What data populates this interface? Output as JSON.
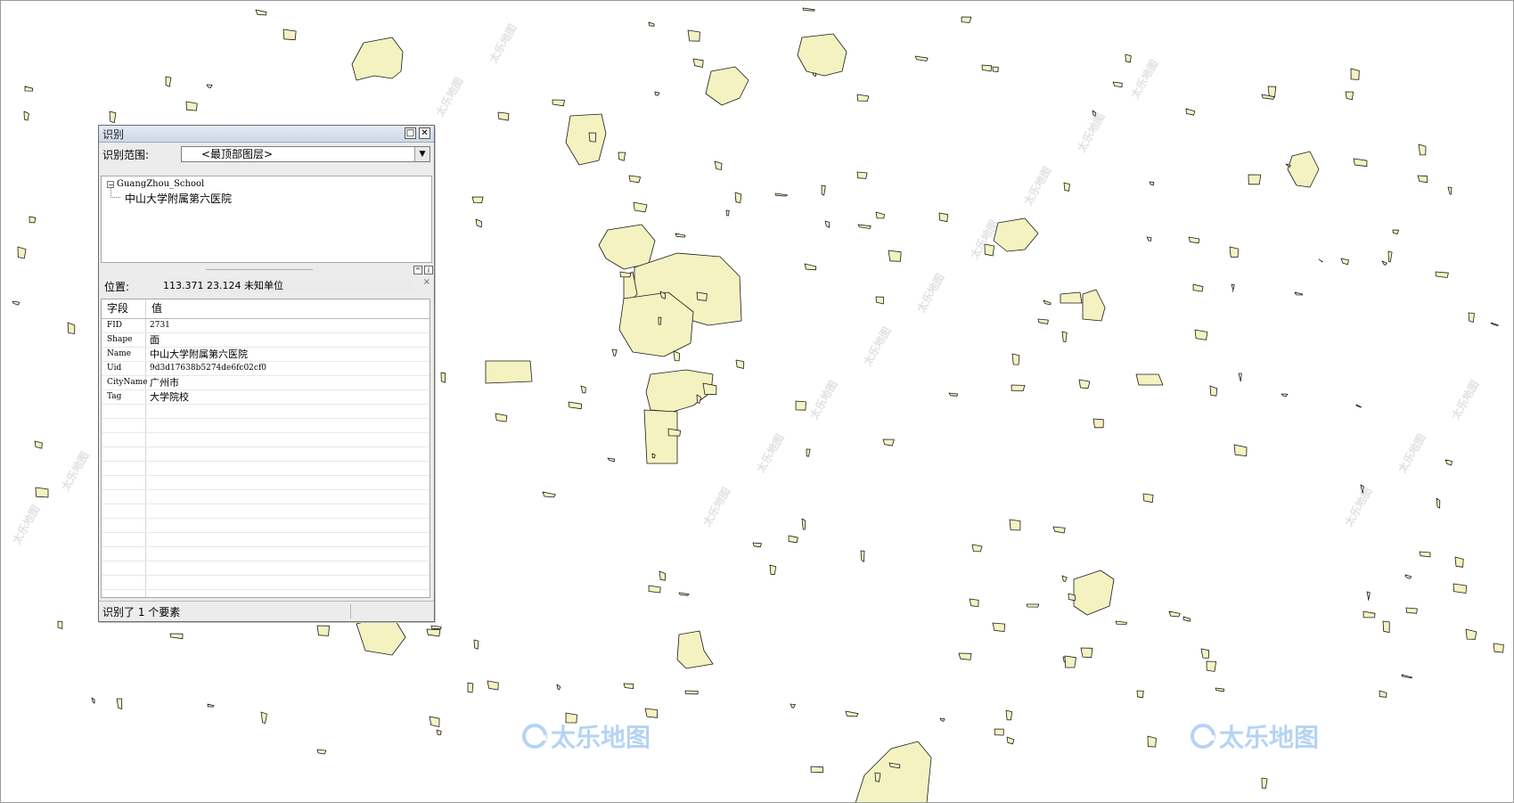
{
  "identify_window": {
    "title": "识别",
    "maximize_glyph": "□",
    "close_glyph": "✕",
    "scope_label": "识别范围:",
    "scope_value": "<最顶部图层>",
    "scope_arrow": "▼",
    "tree": {
      "layer_name": "GuangZhou_School",
      "toggle_glyph": "−",
      "feature_name": "中山大学附属第六医院"
    },
    "splitter": {
      "collapse_glyph": "^",
      "pin_glyph": "i"
    },
    "location": {
      "label": "位置:",
      "value": "113.371  23.124 未知单位",
      "clear_glyph": "×"
    },
    "attributes": {
      "headers": {
        "field": "字段",
        "value": "值"
      },
      "rows": [
        {
          "field": "FID",
          "value": "2731"
        },
        {
          "field": "Shape",
          "value": "面"
        },
        {
          "field": "Name",
          "value": "中山大学附属第六医院"
        },
        {
          "field": "Uid",
          "value": "9d3d17638b5274de6fc02cf0"
        },
        {
          "field": "CityName",
          "value": "广州市"
        },
        {
          "field": "Tag",
          "value": "大学院校"
        }
      ]
    },
    "status": "识别了 1 个要素"
  },
  "watermark": {
    "brand": "太乐地图"
  },
  "colors": {
    "polygon_fill": "#f5f2c1",
    "polygon_stroke": "#1a1a1a",
    "watermark_blue": "#78afeb"
  }
}
